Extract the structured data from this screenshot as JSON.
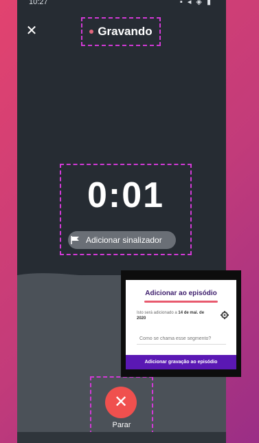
{
  "status_bar": {
    "time": "10:27",
    "icons": "▪ ◂ ◈ ▮"
  },
  "header": {
    "close_label": "✕",
    "title": "Gravando"
  },
  "recorder": {
    "timer": "0:01",
    "marker_button": "Adicionar sinalizador"
  },
  "stop": {
    "label": "Parar",
    "icon": "✕"
  },
  "popup": {
    "title": "Adicionar ao episódio",
    "info_prefix": "Isto será adicionado a ",
    "info_date": "14 de mai. de 2020",
    "input_placeholder": "Como se chama esse segmento?",
    "action_button": "Adicionar gravação ao episódio"
  },
  "colors": {
    "accent": "#d23ad6",
    "stop": "#f0504e",
    "popup_action": "#5a18b4",
    "recording_dot": "#e2687e"
  }
}
